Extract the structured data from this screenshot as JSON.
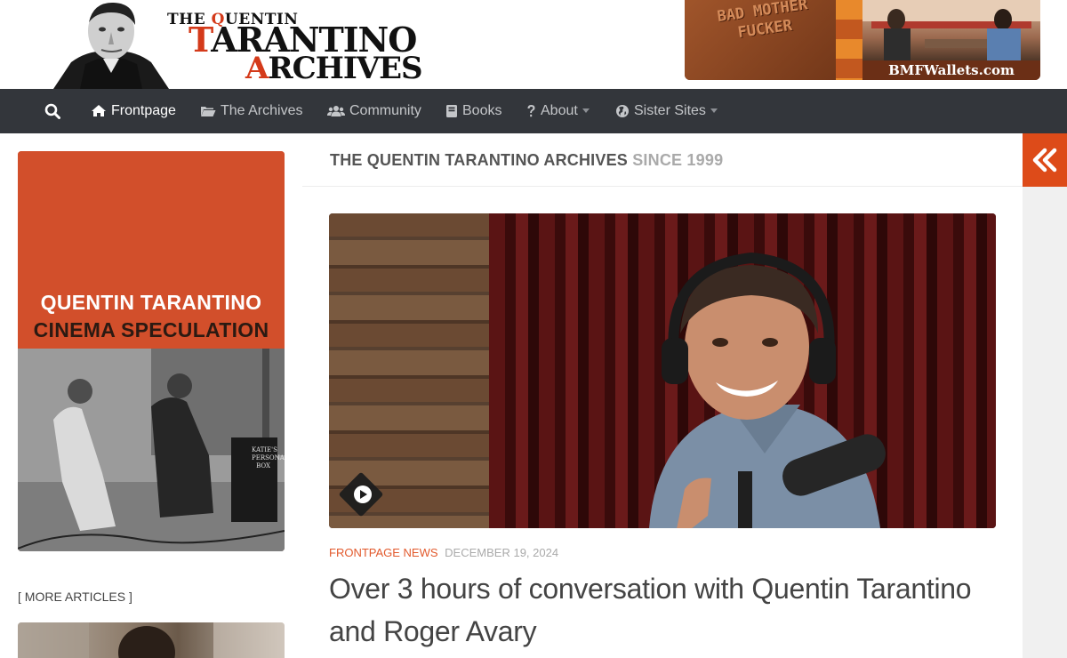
{
  "header": {
    "logo": {
      "line1_prefix": "THE ",
      "line1_initial": "Q",
      "line1_rest": "UENTIN",
      "line2_initial": "T",
      "line2_rest": "ARANTINO",
      "line3_initial": "A",
      "line3_rest": "RCHIVES"
    },
    "ad": {
      "wallet_text": "BAD MOTHER FUCKER",
      "url": "BMFWallets.com"
    }
  },
  "nav": {
    "items": [
      {
        "label": "Frontpage",
        "icon": "home-icon",
        "active": true
      },
      {
        "label": "The Archives",
        "icon": "folder-open-icon"
      },
      {
        "label": "Community",
        "icon": "users-icon"
      },
      {
        "label": "Books",
        "icon": "book-icon"
      },
      {
        "label": "About",
        "icon": "question-icon",
        "dropdown": true
      },
      {
        "label": "Sister Sites",
        "icon": "globe-icon",
        "dropdown": true
      }
    ]
  },
  "sidebar": {
    "book": {
      "author": "QUENTIN TARANTINO",
      "title": "CINEMA SPECULATION",
      "photo_prop_text": "KATIE'S PERSONAL BOX"
    },
    "more_articles": "[ MORE ARTICLES ]"
  },
  "main": {
    "tagline": "THE QUENTIN TARANTINO ARCHIVES",
    "tagline_since": "SINCE 1999",
    "post": {
      "category": "FRONTPAGE NEWS",
      "date": "DECEMBER 19, 2024",
      "title": "Over 3 hours of conversation with Quentin Tarantino and Roger Avary"
    }
  },
  "colors": {
    "accent": "#dd4b19",
    "nav_bg": "#33363b",
    "category": "#e2592c"
  }
}
